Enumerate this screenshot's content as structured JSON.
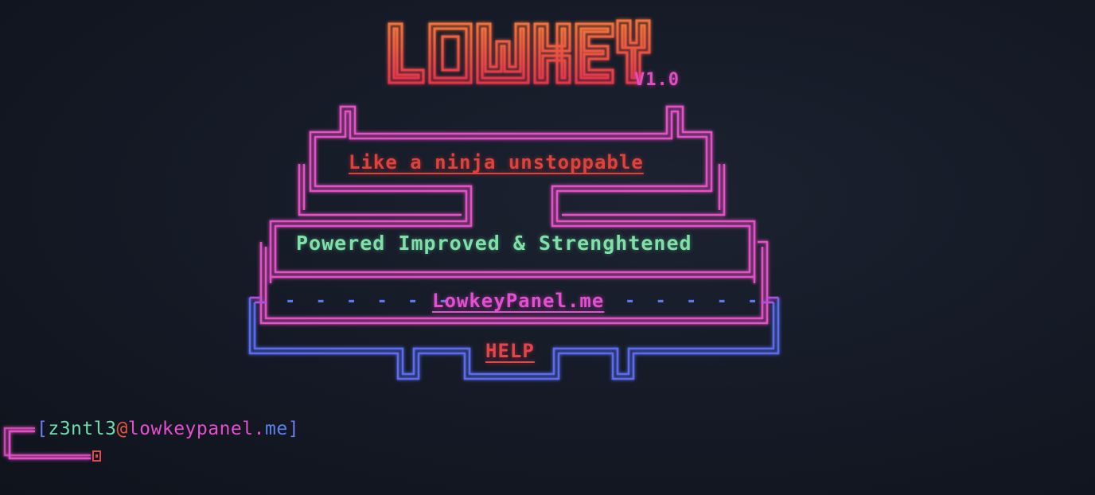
{
  "logo": {
    "title": "LOWKEY",
    "version": "V1.0"
  },
  "banner": {
    "tagline": "Like a ninja unstoppable",
    "subtitle": "Powered Improved & Strenghtened",
    "dashes_left": "- - - - - -",
    "site_link": "LowkeyPanel.me",
    "dashes_right": "- - - - -",
    "help_label": "HELP"
  },
  "prompt": {
    "open_bracket": "[",
    "user": "z3ntl3",
    "at": "@",
    "host": "lowkeypanel",
    "dot": ".",
    "tld": "me",
    "close_bracket": "]"
  },
  "colors": {
    "logo": "#e8552f",
    "frame_pink": "#e64fc6",
    "frame_blue": "#5a6cf0",
    "green_text": "#7fe0a8",
    "red_text": "#e0413a",
    "background": "#141925"
  }
}
